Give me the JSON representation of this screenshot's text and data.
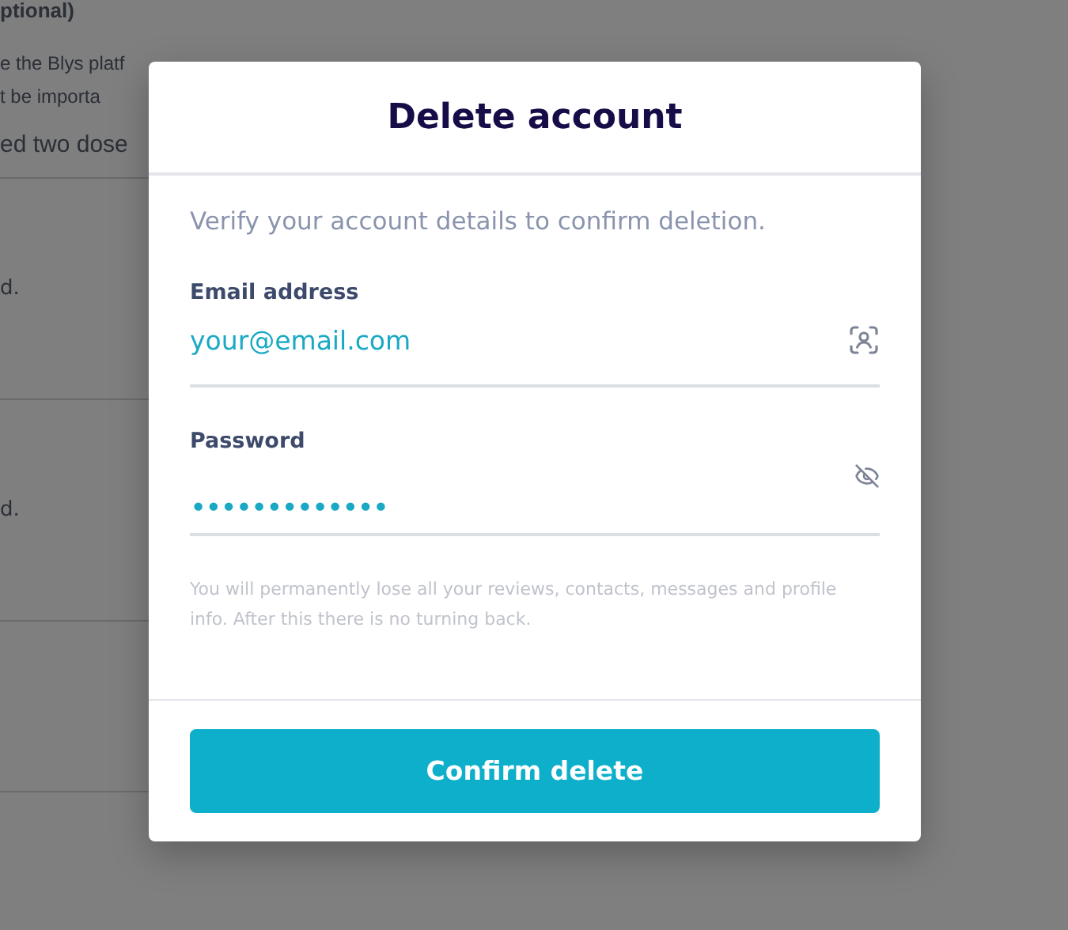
{
  "background_page": {
    "heading": "ptional)",
    "lines": [
      "e the Blys platf",
      "t be importa"
    ],
    "subheading": "ed two dose",
    "rows": [
      {
        "text": "d."
      },
      {
        "text": "d."
      },
      {
        "text": ""
      }
    ]
  },
  "dialog": {
    "title": "Delete account",
    "subtitle": "Verify your account details to confirm deletion.",
    "fields": [
      {
        "kind": "email",
        "label": "Email address",
        "value": "your@email.com"
      },
      {
        "kind": "password",
        "label": "Password",
        "value": "•••••••••••••"
      }
    ],
    "note": "You will permanently lose all your reviews, contacts, messages and profile info. After this there is no turning back.",
    "button": "Confirm delete"
  }
}
